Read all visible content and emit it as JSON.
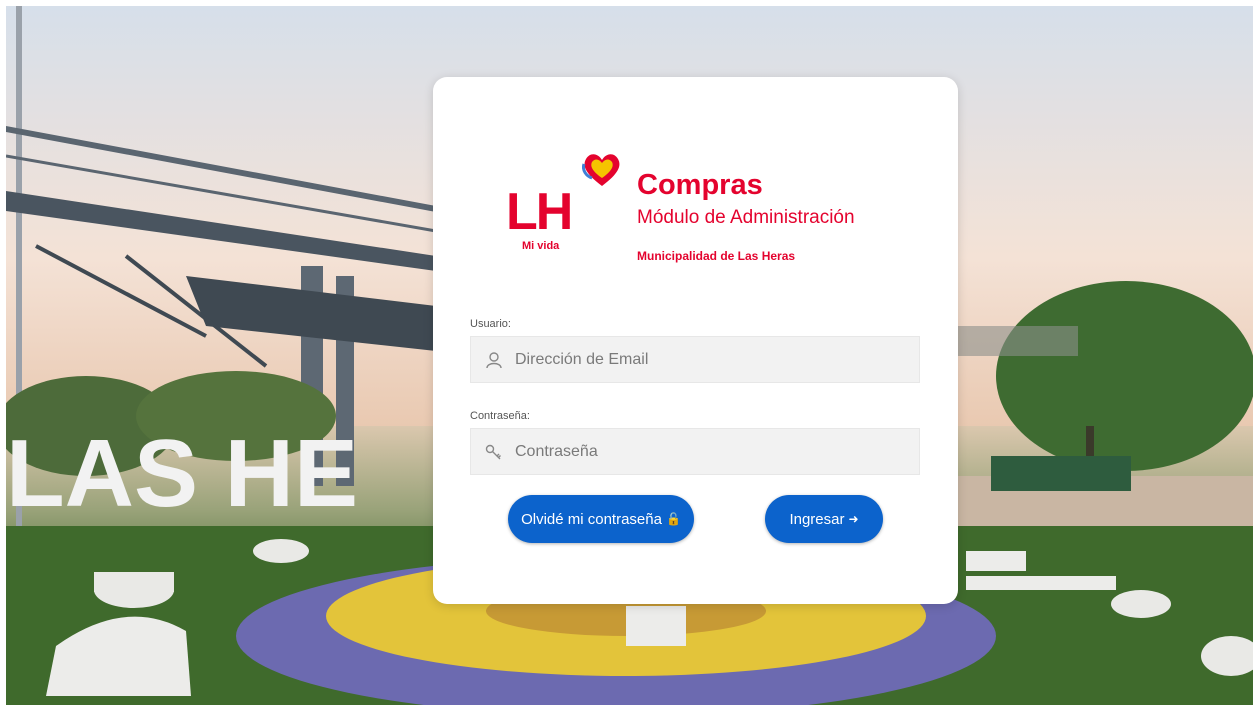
{
  "logo": {
    "lh": "LH",
    "tagline": "Mi vida"
  },
  "header": {
    "title": "Compras",
    "subtitle": "Módulo de Administración",
    "organization": "Municipalidad de Las Heras"
  },
  "background": {
    "sign_text": "LAS HE"
  },
  "form": {
    "user_label": "Usuario:",
    "user_placeholder": "Dirección de Email",
    "password_label": "Contraseña:",
    "password_placeholder": "Contraseña"
  },
  "buttons": {
    "forgot_label": "Olvidé mi contraseña",
    "login_label": "Ingresar"
  },
  "colors": {
    "brand_red": "#e4032e",
    "button_blue": "#0c63cc"
  },
  "icons": {
    "user": "user-icon",
    "key": "key-icon",
    "unlock": "unlock-icon",
    "sign_in": "sign-in-icon"
  }
}
